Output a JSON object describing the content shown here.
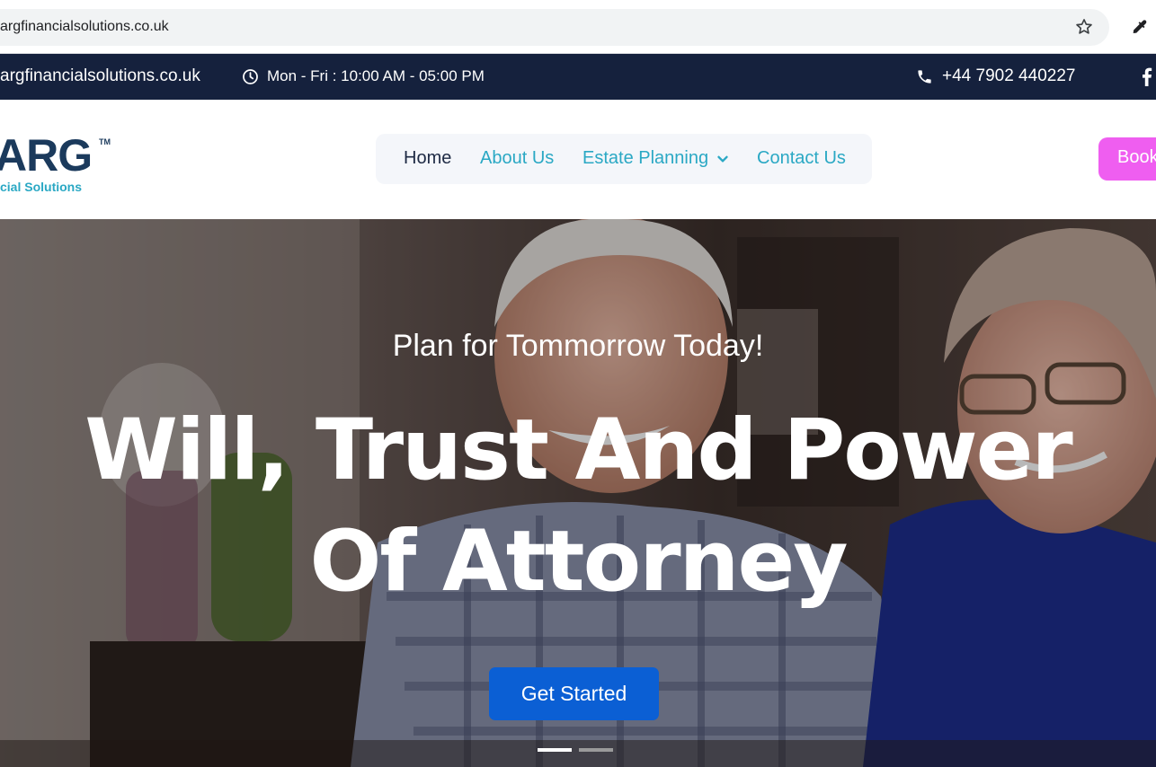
{
  "browser": {
    "url": "argfinancialsolutions.co.uk"
  },
  "topbar": {
    "email": "argfinancialsolutions.co.uk",
    "hours": "Mon - Fri : 10:00 AM - 05:00 PM",
    "phone": "+44 7902 440227",
    "bg_color": "#15213d"
  },
  "header": {
    "logo_mark": "ARG",
    "logo_tm": "TM",
    "logo_sub": "cial Solutions",
    "nav": [
      {
        "label": "Home"
      },
      {
        "label": "About Us"
      },
      {
        "label": "Estate Planning"
      },
      {
        "label": "Contact Us"
      }
    ],
    "book_label": "Book",
    "accent_color": "#2aa8c4",
    "book_color": "#ef5ef0"
  },
  "hero": {
    "kicker": "Plan for Tommorrow Today!",
    "title_line1": "Will, Trust And Power",
    "title_line2": "Of Attorney",
    "cta_label": "Get Started",
    "cta_color": "#0b5fd4",
    "slides": 2,
    "active_slide": 1
  },
  "icons": [
    "star-icon",
    "eyedropper-icon",
    "clock-icon",
    "phone-icon",
    "facebook-icon",
    "chevron-down-icon"
  ]
}
